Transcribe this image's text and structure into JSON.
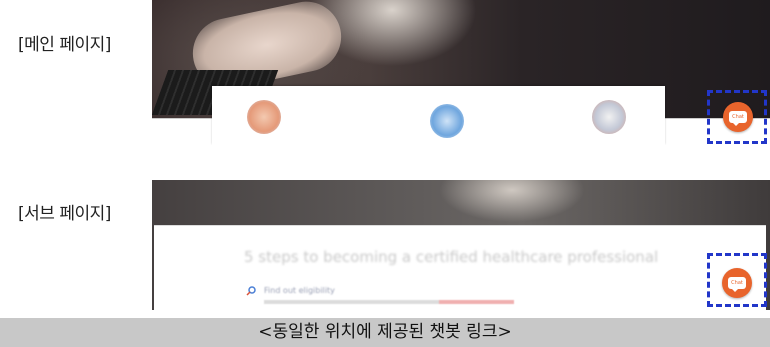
{
  "labels": {
    "main_page": "[메인 페이지]",
    "sub_page": "[서브 페이지]"
  },
  "main_page": {
    "chat_button_label": "Chat",
    "service_icons": [
      "person-service-icon",
      "search-service-icon",
      "settings-service-icon"
    ]
  },
  "sub_page": {
    "title": "5 steps to becoming a certified healthcare professional",
    "link_text": "Find out eligibility",
    "chat_button_label": "Chat"
  },
  "caption": "<동일한 위치에 제공된 챗봇 링크>",
  "colors": {
    "chat_button": "#e8642c",
    "highlight_border": "#2236c9",
    "caption_bg": "#c8c8c8"
  }
}
